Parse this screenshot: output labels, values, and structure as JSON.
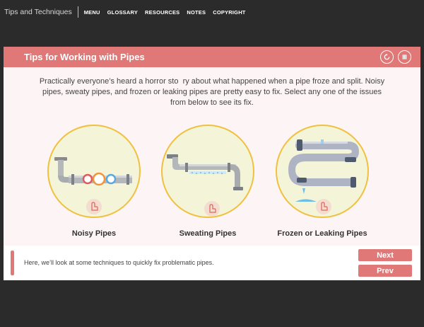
{
  "nav": {
    "course_title": "Tips and Techniques",
    "items": [
      "MENU",
      "GLOSSARY",
      "RESOURCES",
      "NOTES",
      "COPYRIGHT"
    ]
  },
  "panel": {
    "title": "Tips for Working with Pipes",
    "replay_icon": "replay-icon",
    "pause_icon": "pause-icon",
    "intro": "Practically everyone’s heard a horror sto  ry about what happened when a pipe froze and split. Noisy pipes, sweaty pipes, and frozen or leaking pipes are pretty easy to fix. Select any one of the issues from below to see its fix.",
    "choices": [
      {
        "label": "Noisy Pipes",
        "icon": "noisy-pipes-illustration"
      },
      {
        "label": "Sweating Pipes",
        "icon": "sweating-pipes-illustration"
      },
      {
        "label": "Frozen or Leaking Pipes",
        "icon": "frozen-leaking-pipes-illustration"
      }
    ]
  },
  "footer": {
    "text": "Here, we’ll look at some techniques to quickly fix problematic pipes.",
    "next_label": "Next",
    "prev_label": "Prev"
  },
  "colors": {
    "accent": "#e07878",
    "circle_border": "#f0c040",
    "circle_fill": "#f4f4d8",
    "background": "#2b2b2b"
  }
}
